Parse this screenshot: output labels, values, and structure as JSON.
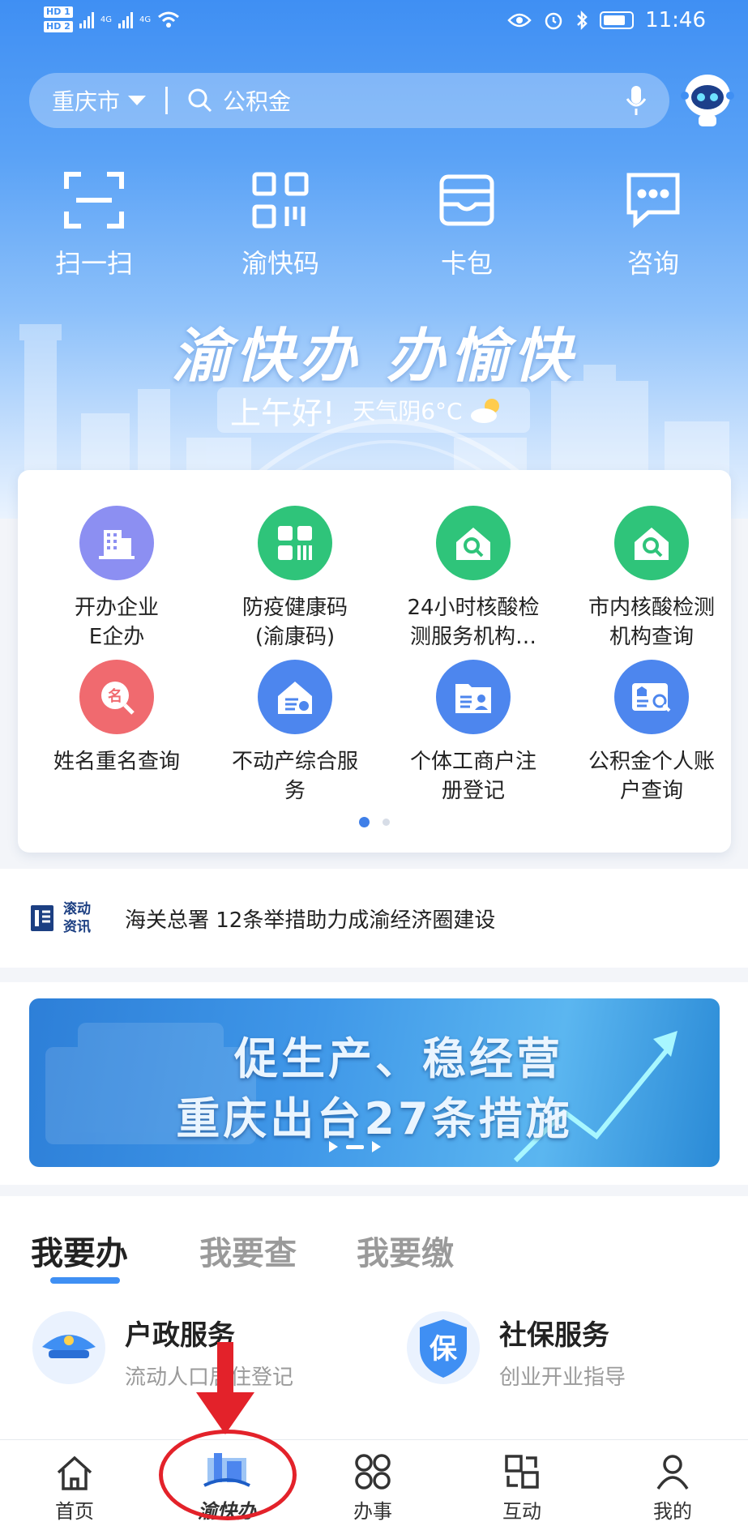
{
  "status_bar": {
    "hd1": "HD 1",
    "hd2": "HD 2",
    "net1": "4G",
    "net2": "4G",
    "time": "11:46"
  },
  "search": {
    "city": "重庆市",
    "placeholder": "公积金"
  },
  "quick_actions": [
    {
      "label": "扫一扫",
      "icon": "scan-icon"
    },
    {
      "label": "渝快码",
      "icon": "qr-code-icon"
    },
    {
      "label": "卡包",
      "icon": "wallet-icon"
    },
    {
      "label": "咨询",
      "icon": "chat-icon"
    }
  ],
  "hero": {
    "slogan": "渝快办 办愉快",
    "greeting": "上午好!",
    "weather": "天气阴6°C"
  },
  "services": [
    {
      "label_line1": "开办企业",
      "label_line2": "E企办",
      "icon": "building-icon",
      "color": "#8c8ff2"
    },
    {
      "label_line1": "防疫健康码",
      "label_line2": "(渝康码)",
      "icon": "health-code-icon",
      "color": "#2fc47a"
    },
    {
      "label_line1": "24小时核酸检",
      "label_line2": "测服务机构…",
      "icon": "nucleic-test-icon",
      "color": "#2fc47a"
    },
    {
      "label_line1": "市内核酸检测",
      "label_line2": "机构查询",
      "icon": "nucleic-search-icon",
      "color": "#2fc47a"
    },
    {
      "label_line1": "姓名重名查询",
      "label_line2": "",
      "icon": "name-search-icon",
      "color": "#f06a6f"
    },
    {
      "label_line1": "不动产综合服",
      "label_line2": "务",
      "icon": "property-icon",
      "color": "#4d86ee"
    },
    {
      "label_line1": "个体工商户注",
      "label_line2": "册登记",
      "icon": "business-register-icon",
      "color": "#4d86ee"
    },
    {
      "label_line1": "公积金个人账",
      "label_line2": "户查询",
      "icon": "fund-account-icon",
      "color": "#4d86ee"
    }
  ],
  "pager": {
    "total": 2,
    "active": 1
  },
  "news": {
    "tag_line1": "滚动",
    "tag_line2": "资讯",
    "headline": "海关总署 12条举措助力成渝经济圈建设"
  },
  "banner": {
    "line1": "促生产、稳经营",
    "line2": "重庆出台27条措施"
  },
  "tabs": [
    {
      "label": "我要办",
      "active": true
    },
    {
      "label": "我要查",
      "active": false
    },
    {
      "label": "我要缴",
      "active": false
    }
  ],
  "service_rows": [
    {
      "title": "户政服务",
      "subtitle": "流动人口居住登记",
      "icon": "police-cap-icon"
    },
    {
      "title": "社保服务",
      "subtitle": "创业开业指导",
      "icon": "shield-bao-icon",
      "badge": "保"
    }
  ],
  "bottom_nav": [
    {
      "label": "首页",
      "icon": "home-icon"
    },
    {
      "label": "渝快办",
      "icon": "brand-icon"
    },
    {
      "label": "办事",
      "icon": "grid-icon"
    },
    {
      "label": "互动",
      "icon": "interact-icon"
    },
    {
      "label": "我的",
      "icon": "user-icon"
    }
  ],
  "annotation": {
    "color": "#e3222a",
    "target": "渝快办"
  },
  "colors": {
    "primary": "#3f8ff3",
    "accent_red": "#e3222a",
    "green": "#2fc47a"
  }
}
